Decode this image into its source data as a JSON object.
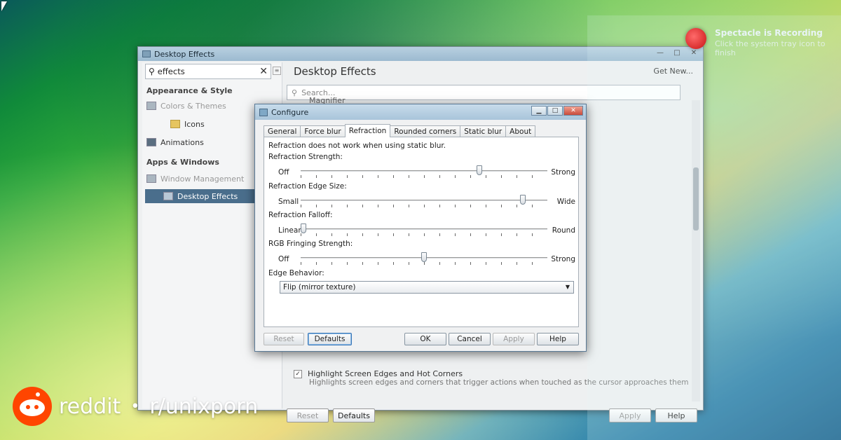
{
  "main_window": {
    "title": "Desktop Effects",
    "sidebar": {
      "search_value": "effects",
      "section_appearance": "Appearance & Style",
      "colors_themes": "Colors & Themes",
      "icons": "Icons",
      "animations": "Animations",
      "section_apps": "Apps & Windows",
      "window_management": "Window Management",
      "desktop_effects": "Desktop Effects"
    },
    "content": {
      "title": "Desktop Effects",
      "get_new": "Get New...",
      "search_placeholder": "Search...",
      "magnifier": "Magnifier",
      "hotcorners_title": "Highlight Screen Edges and Hot Corners",
      "hotcorners_desc": "Highlights screen edges and corners that trigger actions when touched as the cursor approaches them",
      "reset": "Reset",
      "defaults": "Defaults",
      "apply": "Apply",
      "help": "Help"
    }
  },
  "notification": {
    "title": "Spectacle is Recording",
    "subtitle": "Click the system tray icon to finish"
  },
  "dialog": {
    "title": "Configure",
    "tabs": [
      "General",
      "Force blur",
      "Refraction",
      "Rounded corners",
      "Static blur",
      "About"
    ],
    "active_tab": "Refraction",
    "note": "Refraction does not work when using static blur.",
    "sliders": [
      {
        "label": "Refraction Strength:",
        "low": "Off",
        "high": "Strong",
        "value": 0.73
      },
      {
        "label": "Refraction Edge Size:",
        "low": "Small",
        "high": "Wide",
        "value": 0.91
      },
      {
        "label": "Refraction Falloff:",
        "low": "Linear",
        "high": "Round",
        "value": 0.0
      },
      {
        "label": "RGB Fringing Strength:",
        "low": "Off",
        "high": "Strong",
        "value": 0.5
      }
    ],
    "edge_behavior_label": "Edge Behavior:",
    "edge_behavior_value": "Flip (mirror texture)",
    "buttons": {
      "reset": "Reset",
      "defaults": "Defaults",
      "ok": "OK",
      "cancel": "Cancel",
      "apply": "Apply",
      "help": "Help"
    }
  },
  "watermark": {
    "brand": "reddit",
    "bullet": "•",
    "subreddit": "r/unixporn"
  }
}
